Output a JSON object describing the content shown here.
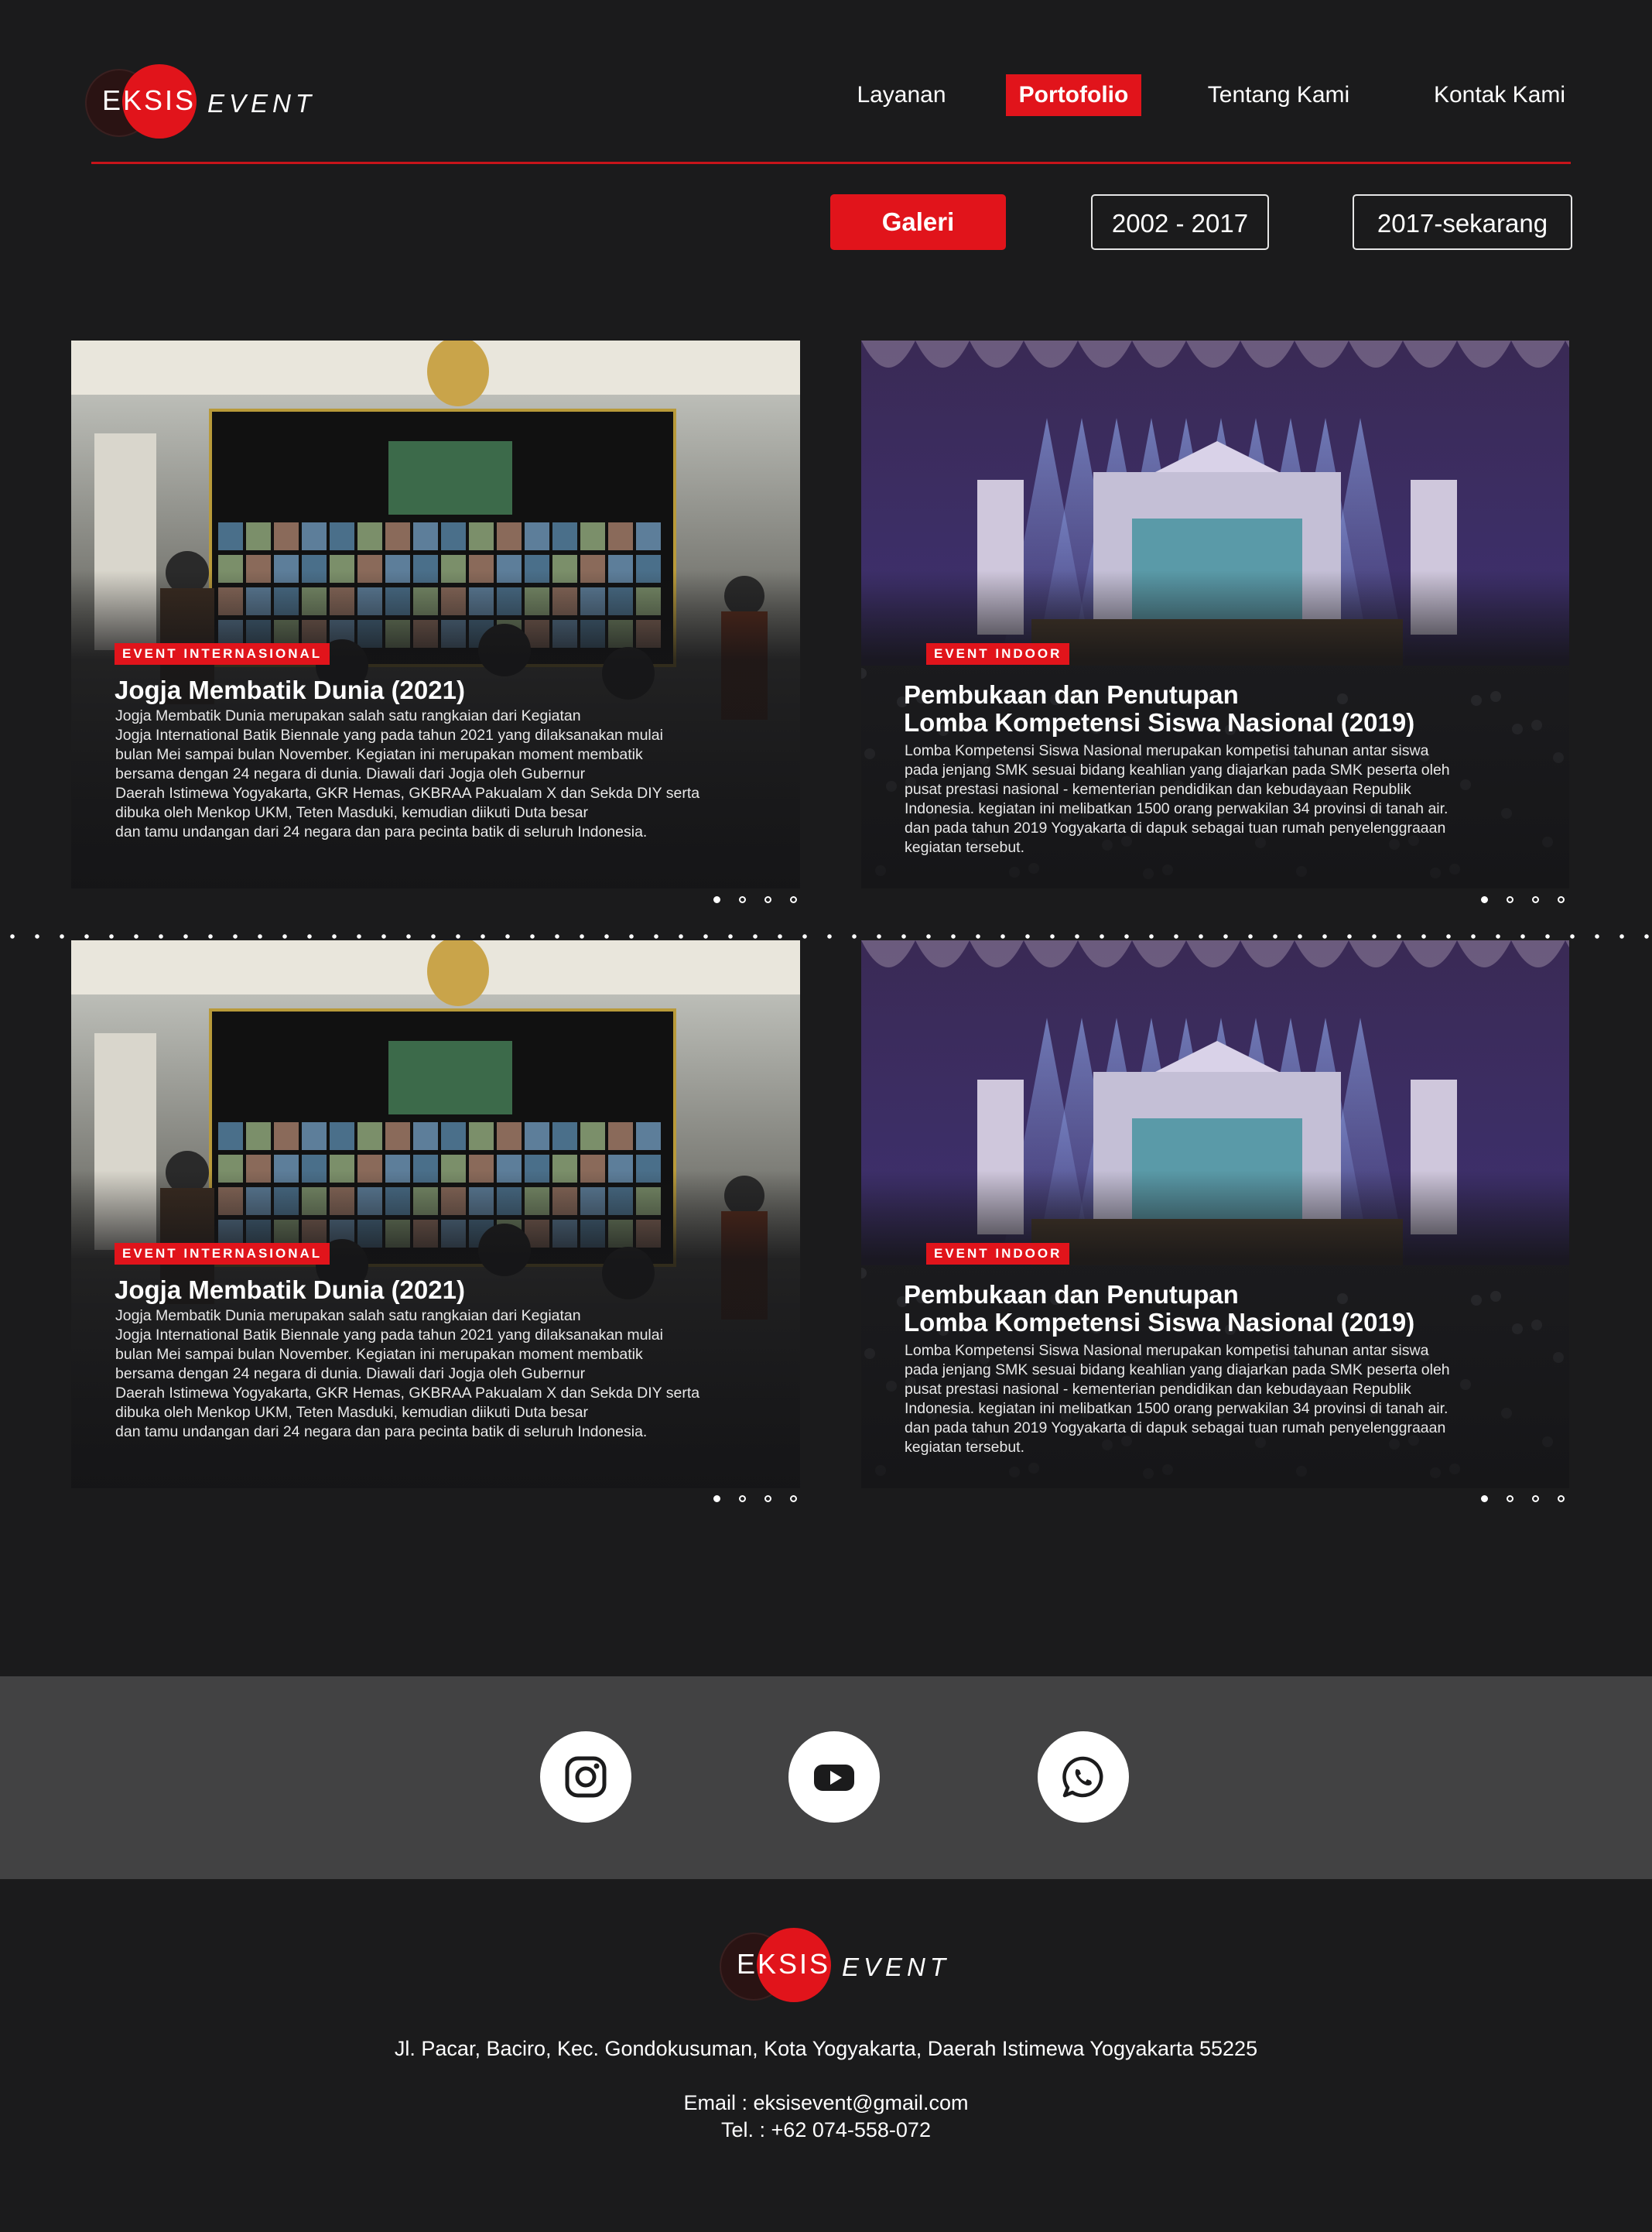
{
  "brand": {
    "word1": "EKSIS",
    "word2": "EVENT"
  },
  "nav": {
    "items": [
      "Layanan",
      "Portofolio",
      "Tentang Kami",
      "Kontak Kami"
    ],
    "active": "Portofolio"
  },
  "filters": {
    "gallery": "Galeri",
    "range1": "2002 - 2017",
    "range2": "2017-sekarang"
  },
  "cards": [
    {
      "tag": "EVENT INTERNASIONAL",
      "title": "Jogja Membatik Dunia (2021)",
      "desc": [
        "Jogja Membatik Dunia merupakan salah satu rangkaian dari Kegiatan",
        "Jogja International Batik Biennale yang pada tahun 2021 yang dilaksanakan mulai",
        "bulan Mei sampai bulan November. Kegiatan ini merupakan moment membatik",
        "bersama dengan 24 negara di dunia. Diawali dari Jogja oleh Gubernur",
        "Daerah Istimewa Yogyakarta, GKR Hemas, GKBRAA Pakualam X dan Sekda DIY serta",
        "dibuka oleh Menkop UKM, Teten Masduki, kemudian diikuti Duta besar",
        "dan tamu undangan dari 24 negara dan para pecinta batik di seluruh Indonesia."
      ]
    },
    {
      "tag": "EVENT INDOOR",
      "title_lines": [
        "Pembukaan dan Penutupan",
        "Lomba Kompetensi Siswa Nasional (2019)"
      ],
      "desc": [
        "Lomba Kompetensi Siswa Nasional merupakan kompetisi tahunan antar siswa",
        "pada jenjang SMK sesuai bidang keahlian yang diajarkan pada SMK peserta oleh",
        "pusat prestasi nasional - kementerian pendidikan dan kebudayaan Republik",
        "Indonesia. kegiatan ini melibatkan 1500 orang perwakilan 34 provinsi di tanah air.",
        "dan pada tahun 2019 Yogyakarta di dapuk sebagai tuan rumah penyelenggraaan",
        "kegiatan tersebut."
      ]
    }
  ],
  "slider": {
    "count": 4,
    "active": 1
  },
  "social": [
    "instagram-icon",
    "youtube-icon",
    "whatsapp-icon"
  ],
  "footer": {
    "address": "Jl. Pacar, Baciro, Kec. Gondokusuman, Kota Yogyakarta, Daerah Istimewa Yogyakarta 55225",
    "email": "Email : eksisevent@gmail.com",
    "tel": "Tel. : +62 074-558-072"
  },
  "colors": {
    "accent": "#e1141b",
    "background": "#1b1b1c",
    "social_band": "#424243"
  }
}
